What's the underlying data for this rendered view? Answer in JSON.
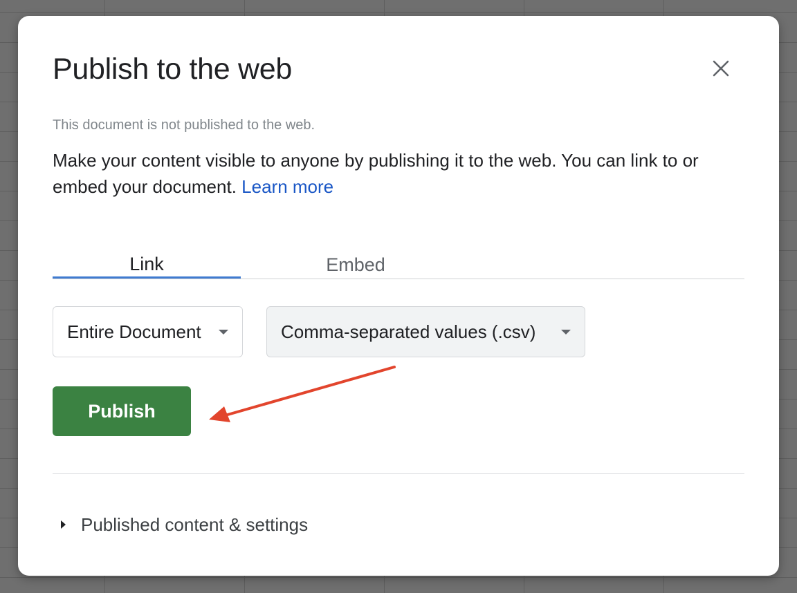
{
  "dialog": {
    "title": "Publish to the web",
    "status": "This document is not published to the web.",
    "description": "Make your content visible to anyone by publishing it to the web. You can link to or embed your document.",
    "learn_more": "Learn more",
    "tabs": [
      {
        "label": "Link",
        "active": true
      },
      {
        "label": "Embed",
        "active": false
      }
    ],
    "range_select": {
      "value": "Entire Document"
    },
    "format_select": {
      "value": "Comma-separated values (.csv)"
    },
    "publish_label": "Publish",
    "published_settings_label": "Published content & settings"
  },
  "icons": {
    "close": "close-icon",
    "dropdown": "chevron-down-icon",
    "expander": "triangle-right-icon",
    "annotation": "arrow-icon"
  },
  "colors": {
    "publish_button": "#3b8242",
    "link": "#1a57c6",
    "active_tab_indicator": "#3f7bd0",
    "annotation_arrow": "#e2452d",
    "backdrop": "#6f6f6f"
  }
}
